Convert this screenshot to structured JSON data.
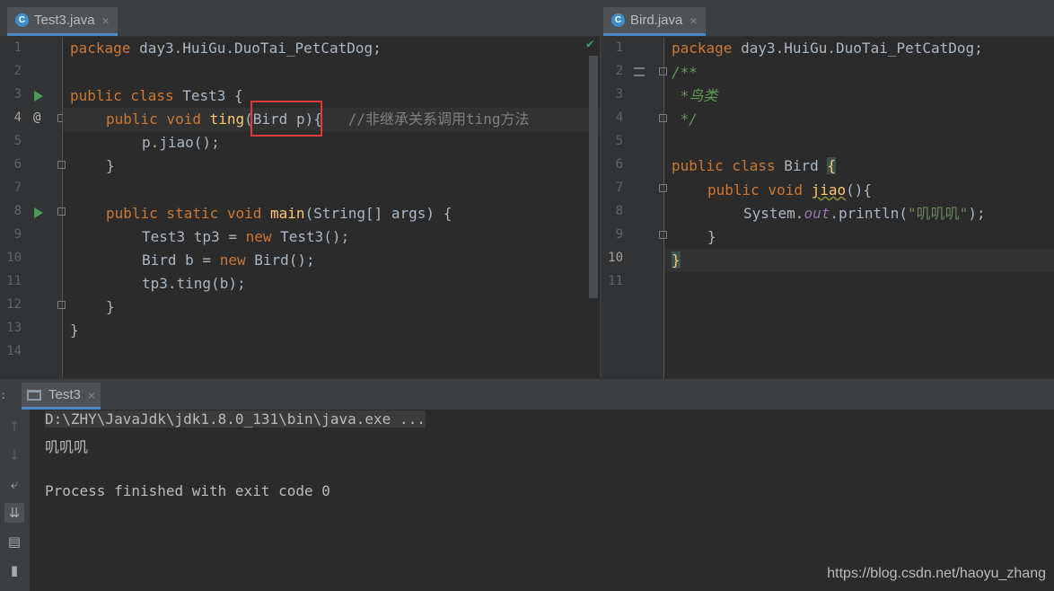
{
  "left_editor": {
    "tab": {
      "icon": "class-icon",
      "label": "Test3.java",
      "close": "×"
    },
    "lines": [
      {
        "num": "1"
      },
      {
        "num": "2"
      },
      {
        "num": "3"
      },
      {
        "num": "4"
      },
      {
        "num": "5"
      },
      {
        "num": "6"
      },
      {
        "num": "7"
      },
      {
        "num": "8"
      },
      {
        "num": "9"
      },
      {
        "num": "10"
      },
      {
        "num": "11"
      },
      {
        "num": "12"
      },
      {
        "num": "13"
      },
      {
        "num": "14"
      }
    ],
    "code": {
      "l1_kw": "package",
      "l1_rest": " day3.HuiGu.DuoTai_PetCatDog;",
      "l3_kw": "public class",
      "l3_rest": " Test3 {",
      "l4_kw": "public void",
      "l4_fn": "ting",
      "l4_rest": "(Bird p){",
      "l4_cm": "//非继承关系调用ting方法",
      "l5": "p.jiao();",
      "l6": "}",
      "l8_kw": "public static void",
      "l8_fn": "main",
      "l8_rest": "(String[] args) {",
      "l9_a": "Test3 tp3 = ",
      "l9_kw": "new",
      "l9_b": " Test3();",
      "l10_a": "Bird b = ",
      "l10_kw": "new",
      "l10_b": " Bird();",
      "l11": "tp3.ting(b);",
      "l12": "}",
      "l13": "}"
    },
    "gutter_markers": {
      "override": "@",
      "check": "✔"
    }
  },
  "right_editor": {
    "tab": {
      "icon": "class-icon",
      "label": "Bird.java",
      "close": "×"
    },
    "lines": [
      {
        "num": "1"
      },
      {
        "num": "2"
      },
      {
        "num": "3"
      },
      {
        "num": "4"
      },
      {
        "num": "5"
      },
      {
        "num": "6"
      },
      {
        "num": "7"
      },
      {
        "num": "8"
      },
      {
        "num": "9"
      },
      {
        "num": "10"
      },
      {
        "num": "11"
      }
    ],
    "code": {
      "l1_kw": "package",
      "l1_rest": " day3.HuiGu.DuoTai_PetCatDog;",
      "l2": "/**",
      "l3": " *鸟类",
      "l4": " */",
      "l6_kw": "public class",
      "l6_rest": " Bird ",
      "l6_brace": "{",
      "l7_kw": "public void",
      "l7_fn": "jiao",
      "l7_rest": "(){",
      "l8_a": "System.",
      "l8_fi": "out",
      "l8_b": ".println(",
      "l8_st": "\"叽叽叽\"",
      "l8_c": ");",
      "l9": "}",
      "l10": "}"
    }
  },
  "run_panel": {
    "tab": {
      "label": "Test3",
      "close": "×"
    },
    "output": [
      "D:\\ZHY\\JavaJdk\\jdk1.8.0_131\\bin\\java.exe ...",
      "叽叽叽",
      "",
      "Process finished with exit code 0"
    ],
    "side_icons": [
      "up-arrow-icon",
      "down-arrow-icon",
      "soft-wrap-icon",
      "scroll-to-end-icon",
      "print-icon",
      "trash-icon"
    ]
  },
  "watermark": "https://blog.csdn.net/haoyu_zhang"
}
